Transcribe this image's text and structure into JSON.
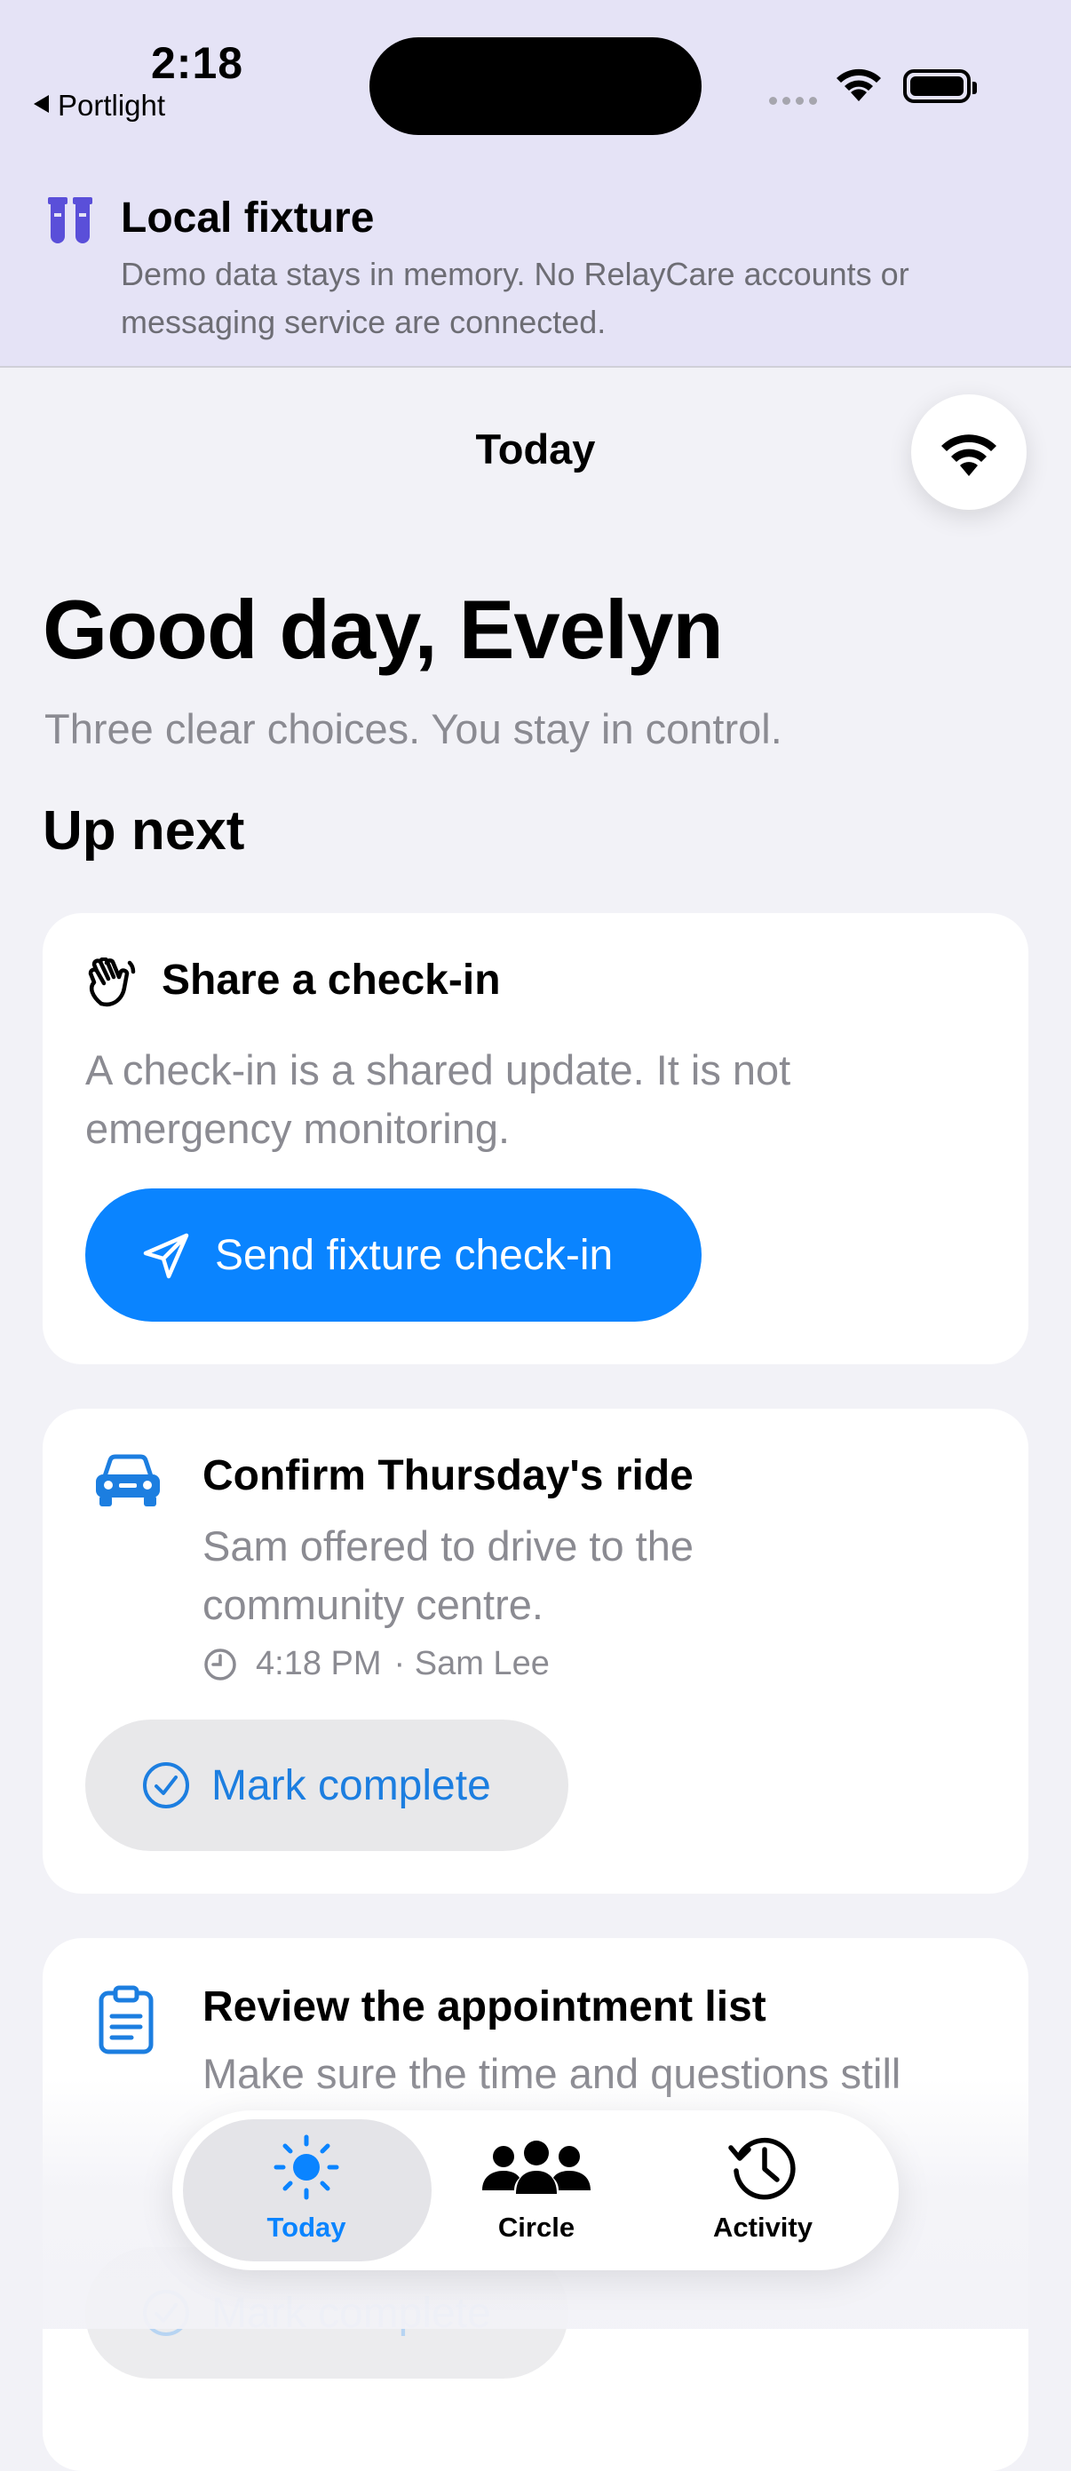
{
  "status_bar": {
    "time": "2:18",
    "back_app": "Portlight"
  },
  "fixture_banner": {
    "icon": "test-tubes-icon",
    "title": "Local fixture",
    "description": "Demo data stays in memory. No RelayCare accounts or messaging service are connected."
  },
  "nav": {
    "title": "Today",
    "connection_icon": "wifi-icon"
  },
  "greeting": {
    "title": "Good day, Evelyn",
    "subtitle": "Three clear choices. You stay in control."
  },
  "section_title": "Up next",
  "cards": [
    {
      "icon": "waving-hand-icon",
      "title": "Share a check-in",
      "description": "A check-in is a shared update. It is not emergency monitoring.",
      "button_label": "Send fixture check-in",
      "button_icon": "paper-plane-icon"
    },
    {
      "icon": "car-icon",
      "title": "Confirm Thursday's ride",
      "description": "Sam offered to drive to the community centre.",
      "time": "4:18 PM",
      "person": "· Sam Lee",
      "button_label": "Mark complete",
      "button_icon": "checkmark-circle-icon"
    },
    {
      "icon": "clipboard-icon",
      "title": "Review the appointment list",
      "description": "Make sure the time and questions still",
      "button_label": "Mark complete",
      "button_icon": "checkmark-circle-icon"
    }
  ],
  "tabs": [
    {
      "label": "Today",
      "icon": "sun-icon",
      "selected": true
    },
    {
      "label": "Circle",
      "icon": "people-icon",
      "selected": false
    },
    {
      "label": "Activity",
      "icon": "clock-history-icon",
      "selected": false
    }
  ],
  "colors": {
    "accent": "#0a84ff",
    "banner_bg": "#e5e3f6",
    "fixture_icon": "#5a4fd9"
  }
}
